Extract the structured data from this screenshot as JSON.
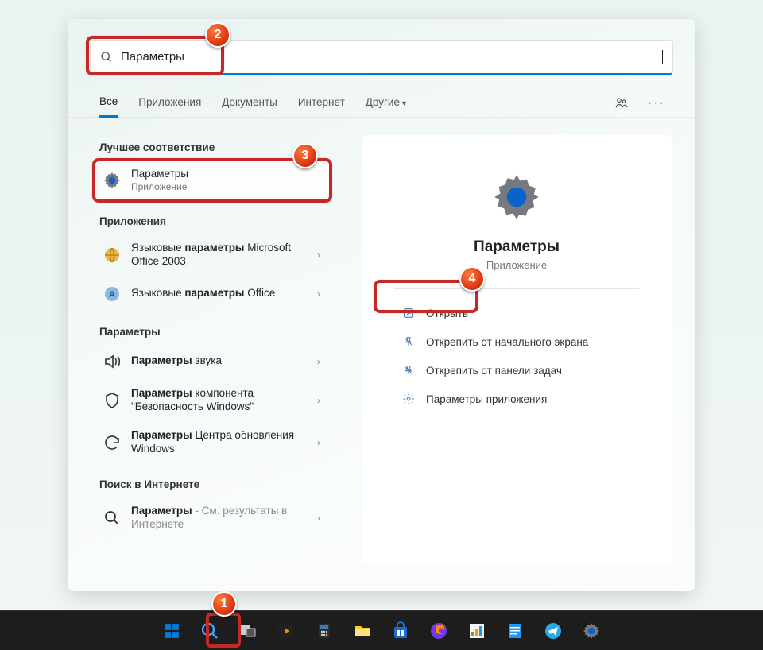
{
  "search": {
    "value": "Параметры"
  },
  "tabs": {
    "all": "Все",
    "apps": "Приложения",
    "docs": "Документы",
    "web": "Интернет",
    "more": "Другие"
  },
  "sections": {
    "best": "Лучшее соответствие",
    "apps": "Приложения",
    "settings": "Параметры",
    "web": "Поиск в Интернете"
  },
  "bestMatch": {
    "title": "Параметры",
    "sub": "Приложение"
  },
  "appResults": [
    {
      "pre": "Языковые ",
      "bold": "параметры",
      "post": " Microsoft Office 2003"
    },
    {
      "pre": "Языковые ",
      "bold": "параметры",
      "post": " Office"
    }
  ],
  "settingResults": [
    {
      "bold": "Параметры",
      "post": " звука"
    },
    {
      "bold": "Параметры",
      "post": " компонента \"Безопасность Windows\""
    },
    {
      "bold": "Параметры",
      "post": " Центра обновления Windows"
    }
  ],
  "webResult": {
    "bold": "Параметры",
    "post": " - См. результаты в Интернете"
  },
  "preview": {
    "title": "Параметры",
    "sub": "Приложение",
    "actions": {
      "open": "Открыть",
      "unpin_start": "Открепить от начального экрана",
      "unpin_taskbar": "Открепить от панели задач",
      "app_settings": "Параметры приложения"
    }
  },
  "badges": {
    "b1": "1",
    "b2": "2",
    "b3": "3",
    "b4": "4"
  }
}
